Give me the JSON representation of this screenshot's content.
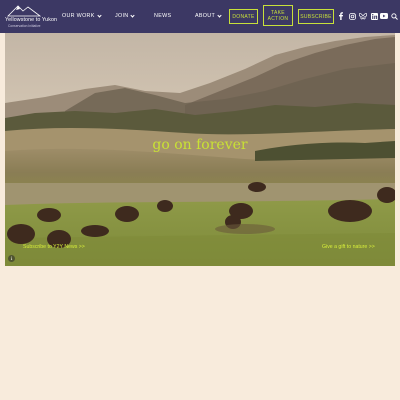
{
  "header": {
    "logo": {
      "name": "Yellowstone to Yukon",
      "tagline": "Conservation Initiative"
    },
    "nav": [
      {
        "label": "OUR WORK",
        "has_dropdown": true
      },
      {
        "label": "JOIN",
        "has_dropdown": true
      },
      {
        "label": "NEWS",
        "has_dropdown": false
      },
      {
        "label": "ABOUT",
        "has_dropdown": true
      }
    ],
    "buttons": {
      "donate": "DONATE",
      "take_action": "TAKE ACTION",
      "subscribe": "SUBSCRIBE"
    },
    "social_icons": [
      "facebook-icon",
      "instagram-icon",
      "bluesky-icon",
      "linkedin-icon",
      "youtube-icon",
      "search-icon"
    ]
  },
  "hero": {
    "tagline": "go on forever",
    "link_left": "Subscribe to Y2Y News >>",
    "link_right": "Give a gift to nature >>",
    "info_icon": "info-icon"
  },
  "colors": {
    "header_bg": "#3c3864",
    "accent": "#c8e03a",
    "page_bg": "#f8ebdc"
  }
}
